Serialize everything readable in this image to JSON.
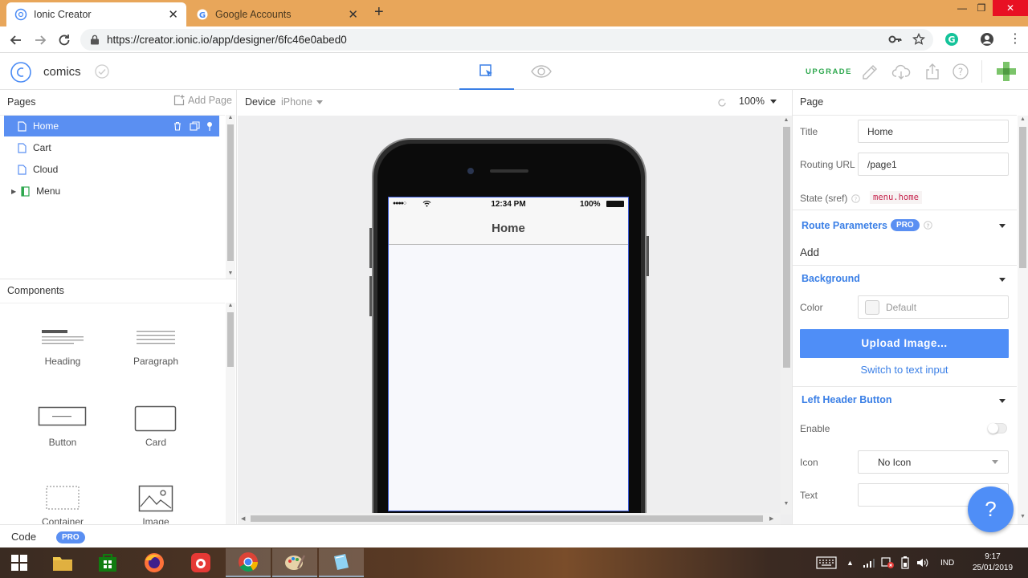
{
  "browser": {
    "tabs": [
      {
        "title": "Ionic Creator",
        "active": true
      },
      {
        "title": "Google Accounts",
        "active": false
      }
    ],
    "new_tab": "+",
    "url": "https://creator.ionic.io/app/designer/6fc46e0abed0",
    "window_controls": {
      "minimize": "—",
      "restore": "❐",
      "close": "✕"
    }
  },
  "app": {
    "project_name": "comics",
    "upgrade_label": "UPGRADE",
    "pages_panel": {
      "title": "Pages",
      "add_page_label": "Add Page",
      "items": [
        {
          "label": "Home",
          "selected": true
        },
        {
          "label": "Cart",
          "selected": false
        },
        {
          "label": "Cloud",
          "selected": false
        },
        {
          "label": "Menu",
          "selected": false
        }
      ]
    },
    "components_panel": {
      "title": "Components",
      "items": [
        "Heading",
        "Paragraph",
        "Button",
        "Card",
        "Container",
        "Image"
      ]
    },
    "canvas": {
      "device_label": "Device",
      "device_value": "iPhone",
      "zoom": "100%",
      "phone": {
        "time": "12:34 PM",
        "battery": "100%",
        "page_title": "Home"
      }
    },
    "properties": {
      "title": "Page",
      "title_label": "Title",
      "title_value": "Home",
      "routing_label": "Routing URL",
      "routing_value": "/page1",
      "state_label": "State (sref)",
      "state_value": "menu.home",
      "route_params_label": "Route Parameters",
      "pro_badge": "PRO",
      "add_label": "Add",
      "background_label": "Background",
      "color_label": "Color",
      "color_value": "Default",
      "upload_label": "Upload Image...",
      "switch_label": "Switch to text input",
      "left_header_label": "Left Header Button",
      "enable_label": "Enable",
      "icon_label": "Icon",
      "icon_value": "No Icon",
      "text_label": "Text",
      "help_label": "?"
    },
    "codebar": {
      "label": "Code",
      "pro": "PRO"
    }
  },
  "taskbar": {
    "lang": "IND",
    "time": "9:17",
    "date": "25/01/2019"
  },
  "colors": {
    "accent": "#5a8ff2",
    "upgrade": "#2fa84f",
    "tabbar": "#e8a65a",
    "link": "#3a7fe6"
  }
}
